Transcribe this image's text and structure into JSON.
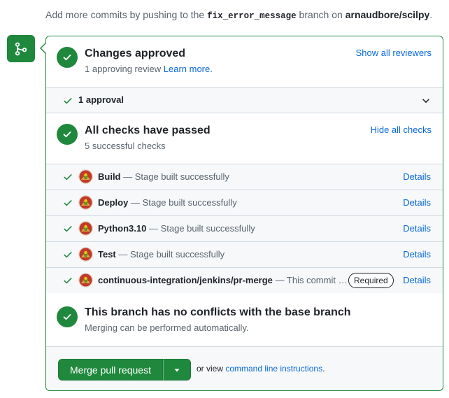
{
  "top_note": {
    "prefix": "Add more commits by pushing to the ",
    "branch": "fix_error_message",
    "middle": " branch on ",
    "repo": "arnaudbore/scilpy",
    "suffix": "."
  },
  "approvals": {
    "title": "Changes approved",
    "subtitle": "1 approving review",
    "learn_more": "Learn more.",
    "show_all": "Show all reviewers",
    "approval_count": "1 approval"
  },
  "checks": {
    "title": "All checks have passed",
    "subtitle": "5 successful checks",
    "hide_all": "Hide all checks",
    "details_label": "Details",
    "required_label": "Required",
    "rows": [
      {
        "name": "Build",
        "desc": " — Stage built successfully"
      },
      {
        "name": "Deploy",
        "desc": " — Stage built successfully"
      },
      {
        "name": "Python3.10",
        "desc": " — Stage built successfully"
      },
      {
        "name": "Test",
        "desc": " — Stage built successfully"
      },
      {
        "name": "continuous-integration/jenkins/pr-merge",
        "desc": " — This commit …"
      }
    ]
  },
  "conflicts": {
    "title": "This branch has no conflicts with the base branch",
    "subtitle": "Merging can be performed automatically."
  },
  "merge": {
    "button": "Merge pull request",
    "or_view": "or view ",
    "cli_link": "command line instructions",
    "cli_suffix": "."
  },
  "icons": {
    "badge": "git-merge-icon",
    "status": "check-circle-icon",
    "row": "check-icon",
    "expand": "chevron-down-icon",
    "dropdown": "triangle-down-icon",
    "avatar": "jenkins-avatar"
  },
  "colors": {
    "success": "#1f883d",
    "link": "#0969da",
    "muted": "#59636e",
    "band": "#f6f8fa"
  }
}
